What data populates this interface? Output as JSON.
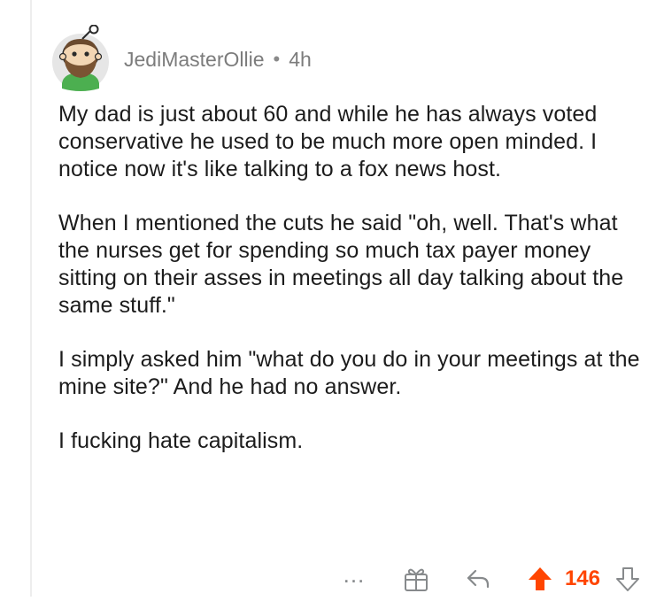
{
  "comment": {
    "author": "JediMasterOllie",
    "separator": "•",
    "age": "4h",
    "paragraphs": [
      "My dad is just about 60 and while he has always voted conservative he used to be much more open minded. I notice now it's like talking to a fox news host.",
      "When I mentioned the cuts he said \"oh, well. That's what the nurses get for spending so much tax payer money sitting on their asses in meetings all day talking about the same stuff.\"",
      "I simply asked him \"what do you do in your meetings at the mine site?\" And he had no answer.",
      "I fucking hate capitalism."
    ]
  },
  "actions": {
    "more_label": "...",
    "score": "146",
    "icons": {
      "more": "more-options-icon",
      "award": "award-gift-icon",
      "reply": "reply-arrow-icon",
      "upvote": "upvote-arrow-icon",
      "downvote": "downvote-arrow-icon"
    },
    "upvote_active": true
  },
  "colors": {
    "upvote_active": "#ff4500",
    "icon_gray": "#878a8c",
    "meta_gray": "#7c7c7c",
    "text": "#1c1c1c",
    "thread_line": "#ededed"
  }
}
